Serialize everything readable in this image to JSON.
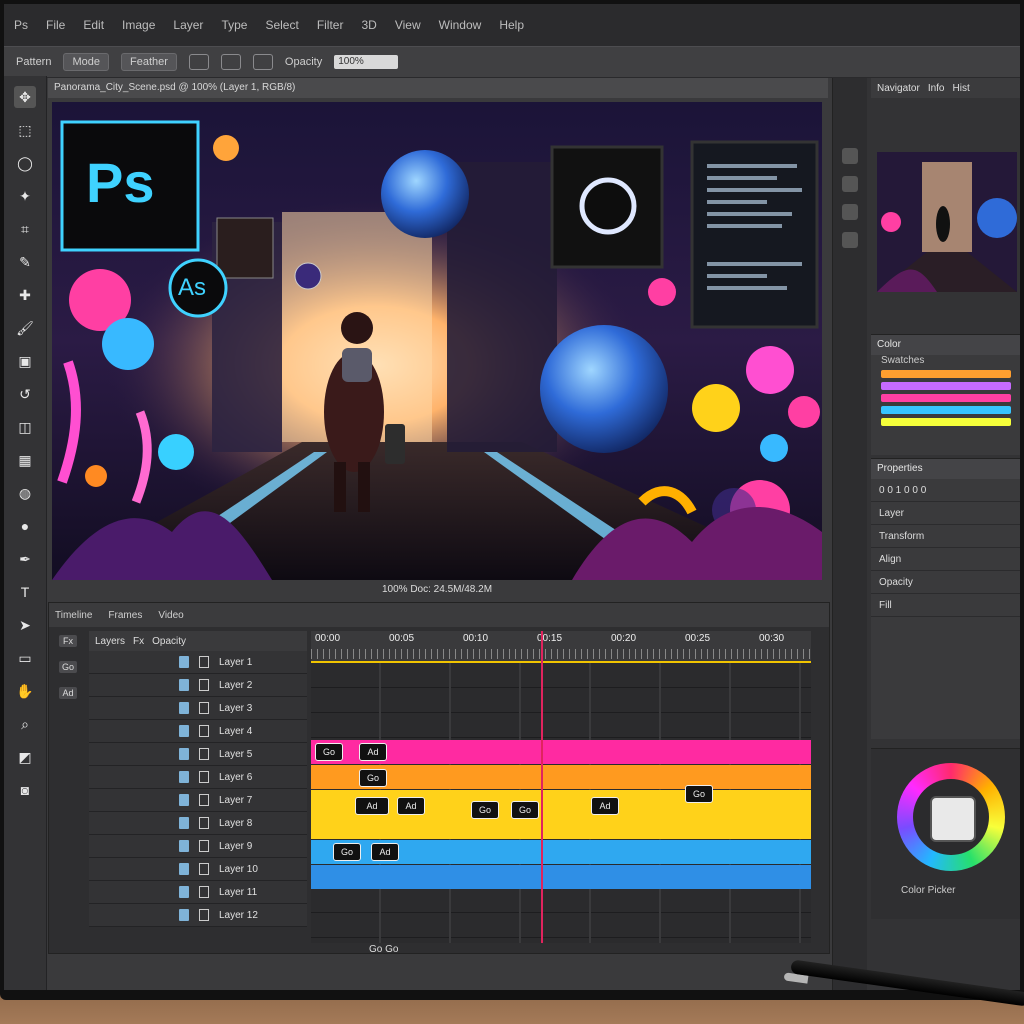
{
  "menubar": {
    "items": [
      "Ps",
      "File",
      "Edit",
      "Image",
      "Layer",
      "Type",
      "Select",
      "Filter",
      "3D",
      "View",
      "Window",
      "Help"
    ]
  },
  "options_bar": {
    "items": [
      "Pattern",
      "Mode",
      "Feather",
      "Opacity"
    ],
    "field_value": "100%"
  },
  "document": {
    "title": "Panorama_City_Scene.psd @ 100% (Layer 1, RGB/8)"
  },
  "canvas": {
    "logo_ps": "Ps",
    "logo_as": "As"
  },
  "status_bar": {
    "text": "100%  Doc: 24.5M/48.2M"
  },
  "timeline": {
    "header": [
      "Timeline",
      "Frames",
      "Video"
    ],
    "layers_header": [
      "Layers",
      "Fx",
      "Opacity"
    ],
    "layer_labels": [
      "Layer 1",
      "Layer 2",
      "Layer 3",
      "Layer 4",
      "Layer 5",
      "Layer 6",
      "Layer 7",
      "Layer 8",
      "Layer 9",
      "Layer 10",
      "Layer 11",
      "Layer 12"
    ],
    "ruler_labels": [
      "00:00",
      "00:05",
      "00:10",
      "00:15",
      "00:20",
      "00:25",
      "00:30"
    ],
    "side_labels": [
      "Fx",
      "Go",
      "Ad"
    ],
    "bottom_label": "Go Go",
    "clip_labels": [
      "Go",
      "Ad",
      "Go",
      "Ad",
      "Ad",
      "Go",
      "Go",
      "Ad",
      "Go",
      "Go",
      "Ad"
    ],
    "band_colors": [
      "#ff2aa1",
      "#ff9a1f",
      "#ffd21a",
      "#2fa8f0",
      "#2f8fe6"
    ],
    "playhead_percent": 46
  },
  "right_panel": {
    "header": [
      "Navigator",
      "Info",
      "Hist"
    ],
    "section_color": {
      "title": "Color",
      "subtitle": "Swatches"
    },
    "swatch_colors": [
      "#ff9f2f",
      "#c66bff",
      "#ff3fa3",
      "#36c4ff",
      "#f5ff3a"
    ],
    "section_props": {
      "title": "Properties"
    },
    "props_values": "0 0 1 0 0 0",
    "props_rows": [
      "Layer",
      "Transform",
      "Align",
      "Opacity",
      "Fill"
    ],
    "color_wheel_label": "Color Picker"
  }
}
